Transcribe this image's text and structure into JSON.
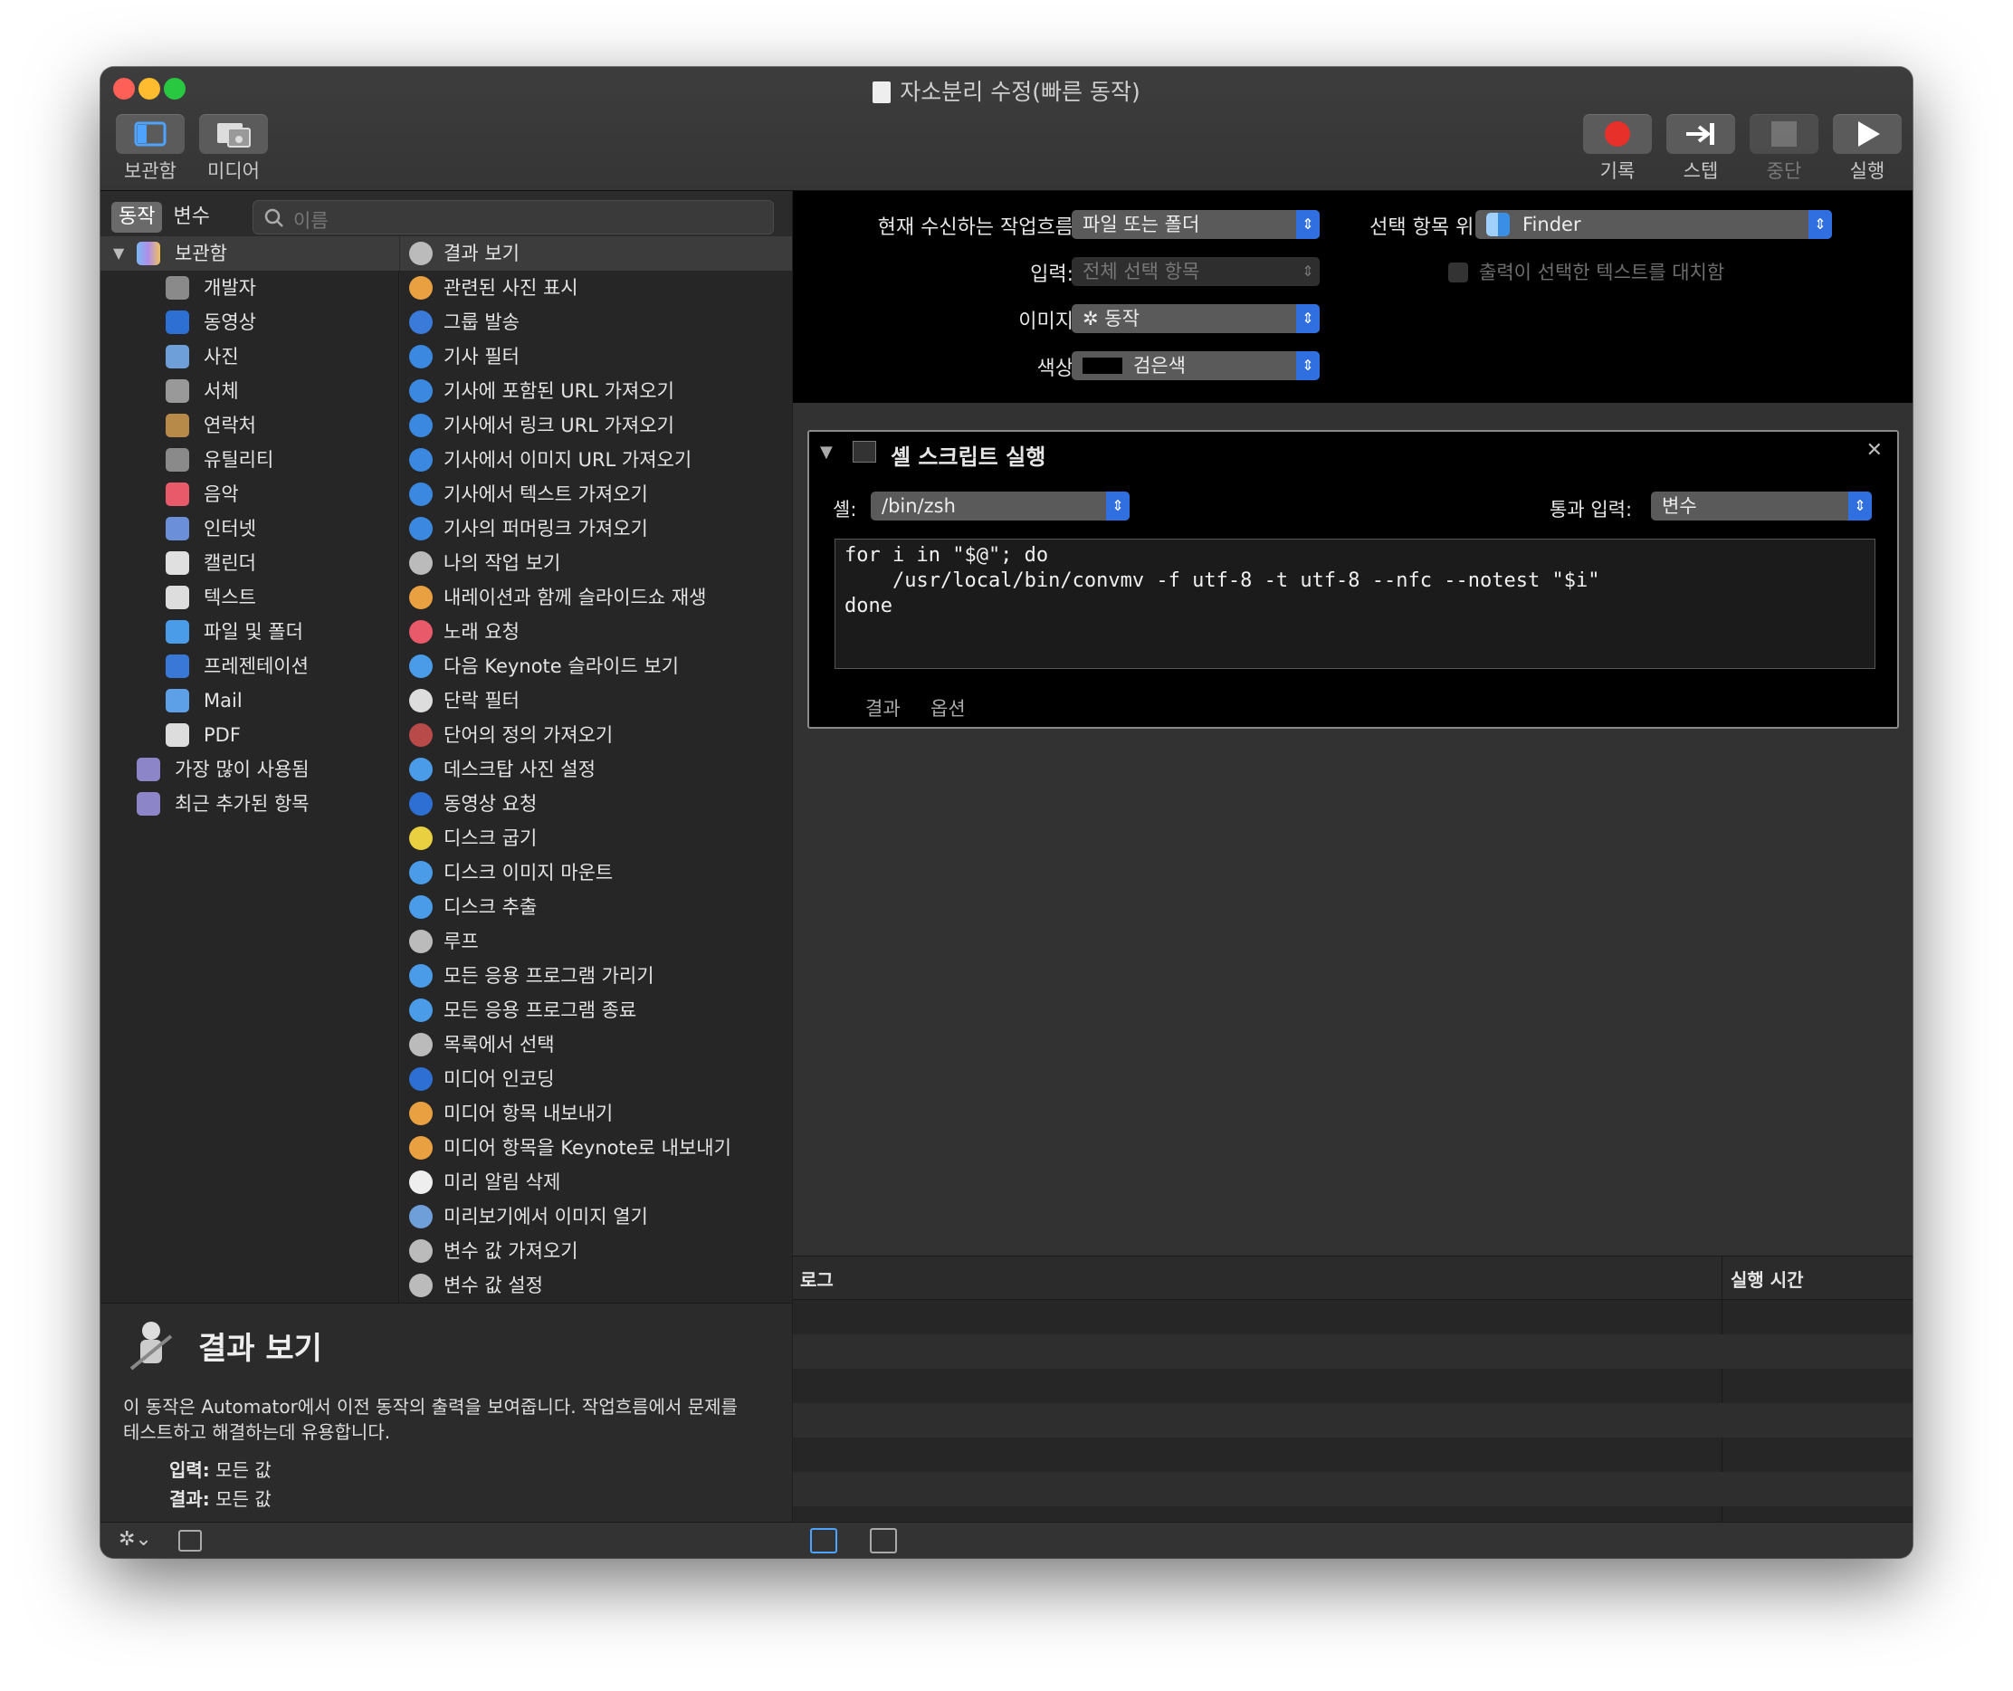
{
  "window": {
    "title": "자소분리 수정(빠른 동작)"
  },
  "toolbar": {
    "library_label": "보관함",
    "media_label": "미디어",
    "record_label": "기록",
    "step_label": "스텝",
    "stop_label": "중단",
    "run_label": "실행"
  },
  "left": {
    "tabs": [
      "동작",
      "변수"
    ],
    "search_placeholder": "이름",
    "library_title": "보관함",
    "categories": [
      "개발자",
      "동영상",
      "사진",
      "서체",
      "연락처",
      "유틸리티",
      "음악",
      "인터넷",
      "캘린더",
      "텍스트",
      "파일 및 폴더",
      "프레젠테이션",
      "Mail",
      "PDF"
    ],
    "smart_groups": [
      "가장 많이 사용됨",
      "최근 추가된 항목"
    ],
    "actions": [
      "결과 보기",
      "관련된 사진 표시",
      "그룹 발송",
      "기사 필터",
      "기사에 포함된 URL 가져오기",
      "기사에서 링크 URL 가져오기",
      "기사에서 이미지 URL 가져오기",
      "기사에서 텍스트 가져오기",
      "기사의 퍼머링크 가져오기",
      "나의 작업 보기",
      "내레이션과 함께 슬라이드쇼 재생",
      "노래 요청",
      "다음 Keynote 슬라이드 보기",
      "단락 필터",
      "단어의 정의 가져오기",
      "데스크탑 사진 설정",
      "동영상 요청",
      "디스크 굽기",
      "디스크 이미지 마운트",
      "디스크 추출",
      "루프",
      "모든 응용 프로그램 가리기",
      "모든 응용 프로그램 종료",
      "목록에서 선택",
      "미디어 인코딩",
      "미디어 항목 내보내기",
      "미디어 항목을 Keynote로 내보내기",
      "미리 알림 삭제",
      "미리보기에서 이미지 열기",
      "변수 값 가져오기",
      "변수 값 설정"
    ],
    "desc_title": "결과 보기",
    "desc_line1": "이 동작은 Automator에서 이전 동작의 출력을 보여줍니다. 작업흐름에서 문제를",
    "desc_line2": "테스트하고 해결하는데 유용합니다.",
    "input_label": "입력:",
    "input_value": "모든 값",
    "result_label": "결과:",
    "result_value": "모든 값"
  },
  "prefs": {
    "receives_label": "현재 수신하는 작업흐름",
    "receives_value": "파일 또는 폴더",
    "location_label": "선택 항목 위치:",
    "location_value": "Finder",
    "input_label": "입력:",
    "input_value": "전체 선택 항목",
    "replace_label": "출력이 선택한 텍스트를 대치함",
    "image_label": "이미지",
    "image_value": "동작",
    "color_label": "색상",
    "color_value": "검은색"
  },
  "action": {
    "title": "셸 스크립트 실행",
    "shell_label": "셸:",
    "shell_value": "/bin/zsh",
    "pass_label": "통과 입력:",
    "pass_value": "변수",
    "code_lines": [
      "for i in \"$@\"; do",
      "    /usr/local/bin/convmv -f utf-8 -t utf-8 --nfc --notest \"$i\"",
      "done"
    ],
    "tab_results": "결과",
    "tab_options": "옵션"
  },
  "log": {
    "col_log": "로그",
    "col_time": "실행 시간"
  }
}
